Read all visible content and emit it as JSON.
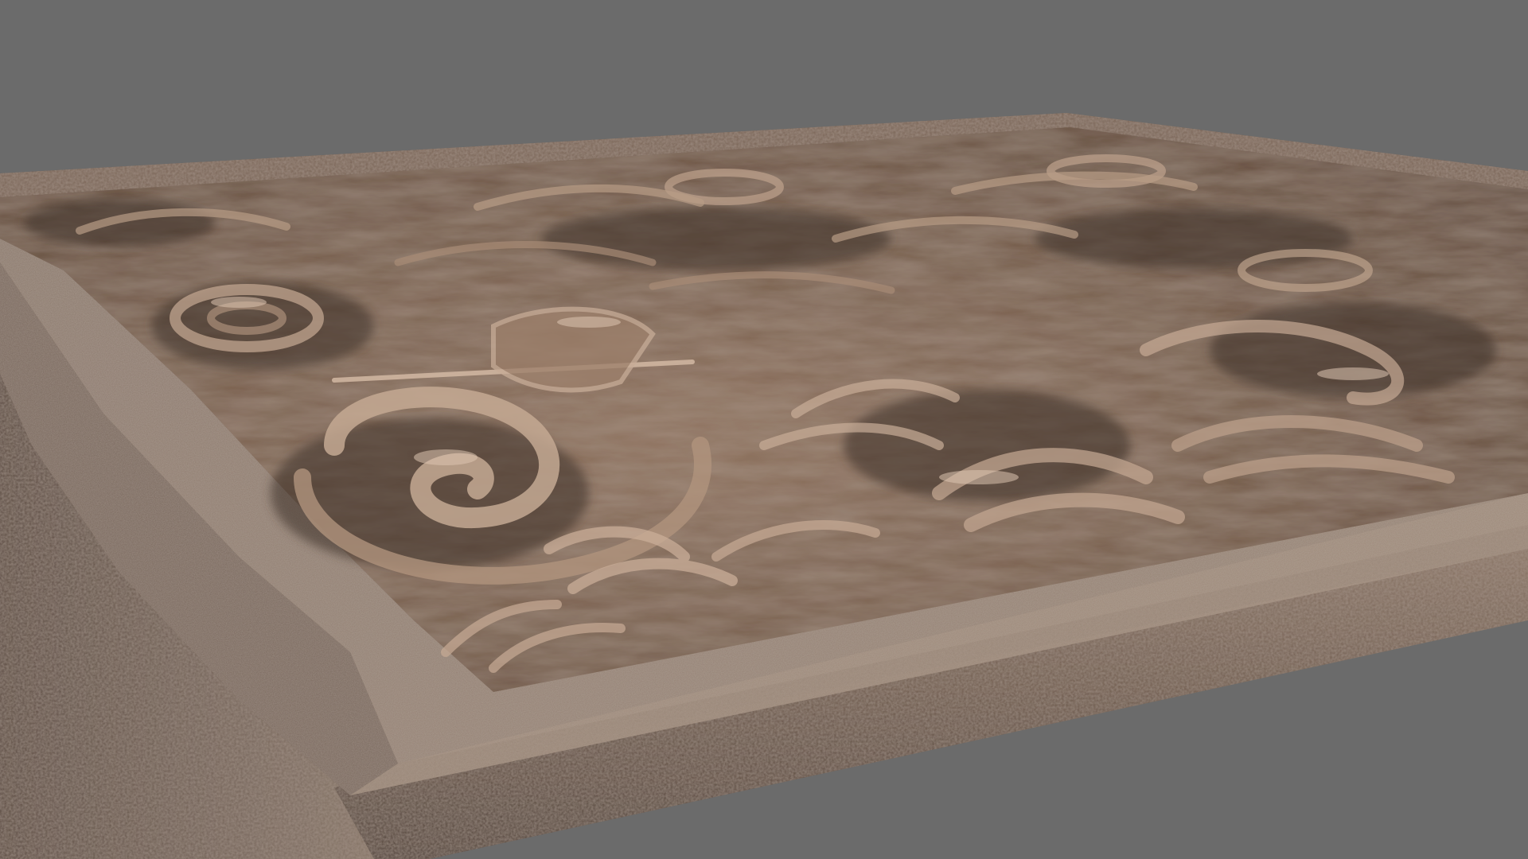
{
  "scene": {
    "subject": "carved-relief-panel",
    "colors": {
      "background": "#6b6b6b",
      "leather_frame": "#6e5a4c",
      "leather_frame_light": "#8a7566",
      "suede_inner": "#8f7c6e",
      "wood_base": "#7a6150",
      "wood_highlight": "#b89c86",
      "wood_shadow": "#3e3028"
    }
  }
}
